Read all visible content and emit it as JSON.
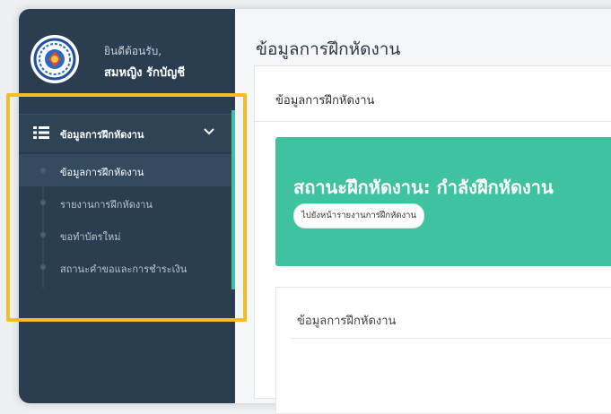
{
  "user": {
    "welcome": "ยินดีต้อนรับ,",
    "name": "สมหญิง รักบัญชี"
  },
  "sidebar": {
    "menu_label": "ข้อมูลการฝึกหัดงาน",
    "items": [
      {
        "label": "ข้อมูลการฝึกหัดงาน",
        "active": true
      },
      {
        "label": "รายงานการฝึกหัดงาน",
        "active": false
      },
      {
        "label": "ขอทำบัตรใหม่",
        "active": false
      },
      {
        "label": "สถานะคำขอและการชำระเงิน",
        "active": false
      }
    ]
  },
  "main": {
    "page_title": "ข้อมูลการฝึกหัดงาน",
    "card_title": "ข้อมูลการฝึกหัดงาน",
    "status_text": "สถานะฝึกหัดงาน: กำลังฝึกหัดงาน",
    "status_button": "ไปยังหน้ารายงานการฝึกหัดงาน",
    "sub_card_title": "ข้อมูลการฝึกหัดงาน"
  },
  "colors": {
    "sidebar": "#2b3d50",
    "accent": "#3ec2a0",
    "highlight": "#f5bd25"
  }
}
